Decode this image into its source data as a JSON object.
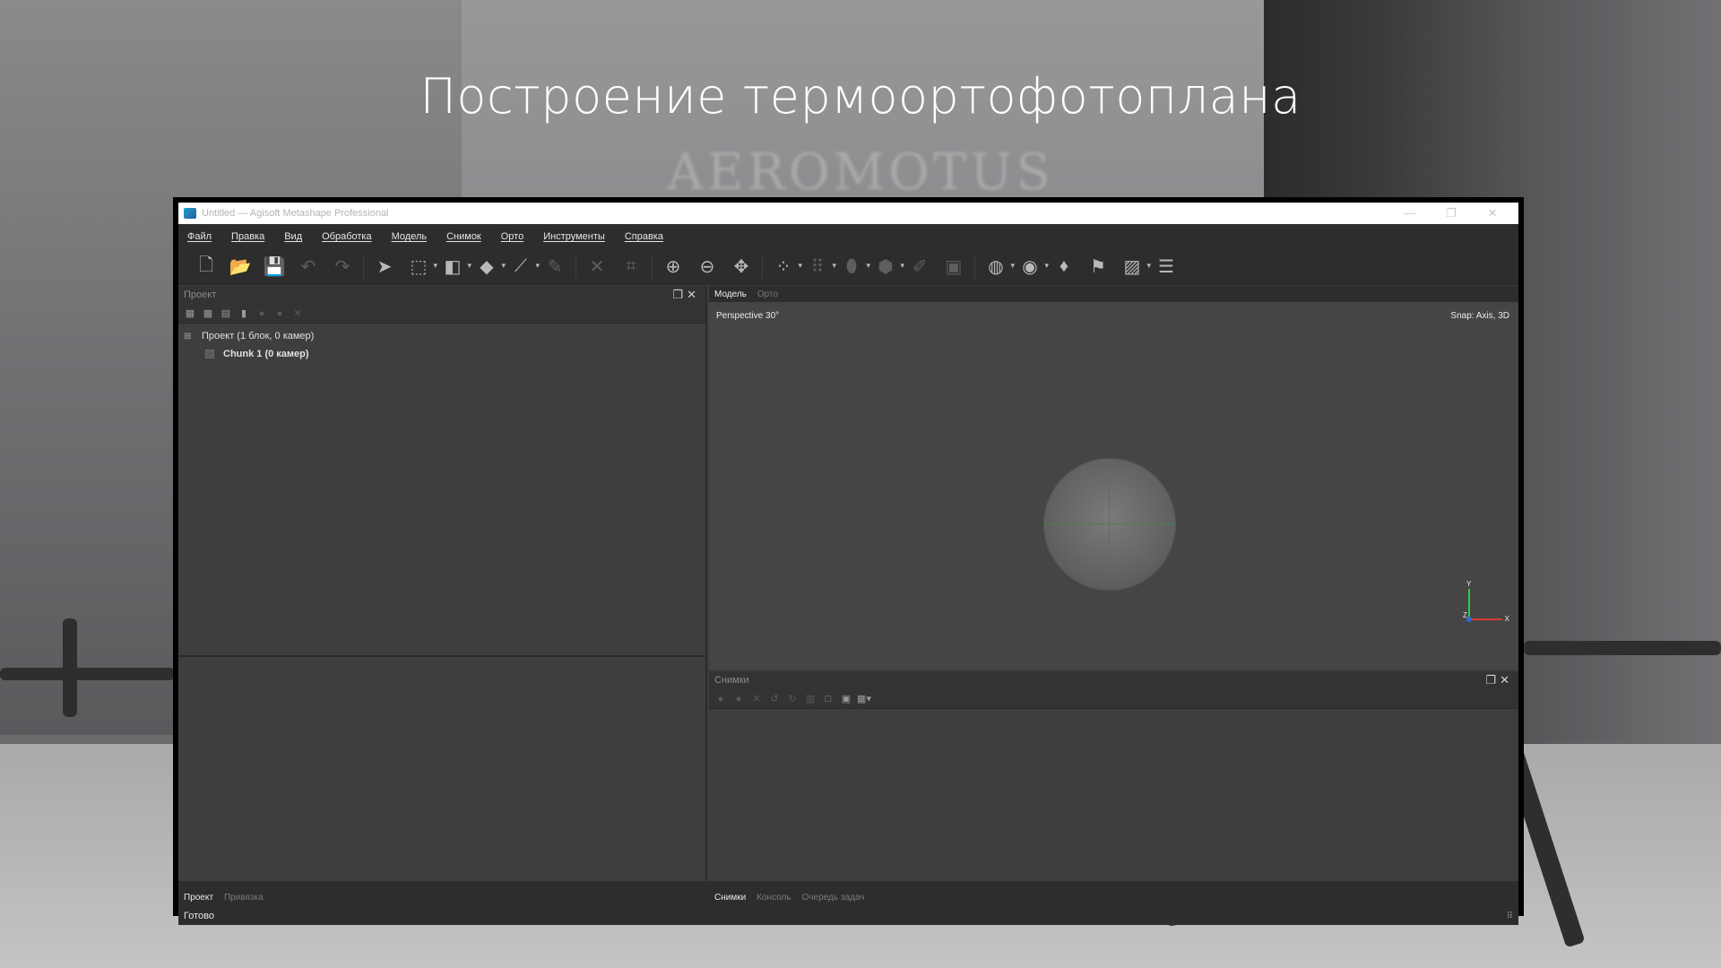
{
  "slide": {
    "title": "Построение термоортофотоплана",
    "background_logo": "AEROMOTUS"
  },
  "window": {
    "title": "Untitled — Agisoft Metashape Professional",
    "controls": [
      "—",
      "❐",
      "✕"
    ]
  },
  "menu": [
    "Файл",
    "Правка",
    "Вид",
    "Обработка",
    "Модель",
    "Снимок",
    "Орто",
    "Инструменты",
    "Справка"
  ],
  "toolbar": {
    "icons": [
      "new-file-icon",
      "open-folder-icon",
      "save-icon",
      "undo-icon",
      "redo-icon",
      "pointer-icon",
      "rectangle-select-icon",
      "shape-icon",
      "polygon-icon",
      "ruler-icon",
      "pencil-icon",
      "delete-icon",
      "crop-icon",
      "zoom-in-icon",
      "zoom-out-icon",
      "move-icon",
      "points-icon",
      "grid-points-icon",
      "mesh-icon",
      "texture-icon",
      "brush-icon",
      "tile-icon",
      "globe-icon",
      "camera-icon",
      "marker-icon",
      "flag-icon",
      "ortho-icon",
      "layers-icon"
    ]
  },
  "project_panel": {
    "header": "Проект",
    "tree": [
      {
        "label": "Проект (1 блок, 0 камер)"
      },
      {
        "label": "Chunk 1 (0 камер)"
      }
    ],
    "tabs": {
      "active": "Проект",
      "inactive": "Привязка"
    }
  },
  "viewport": {
    "tabs": {
      "active": "Модель",
      "inactive": "Орто"
    },
    "perspective_label": "Perspective 30°",
    "snap_label": "Snap: Axis, 3D",
    "axes": {
      "y": "Y",
      "x": "X",
      "z": "Z"
    }
  },
  "photos_panel": {
    "header": "Снимки",
    "tabs": {
      "active": "Снимки",
      "inactive1": "Консоль",
      "inactive2": "Очередь задач"
    }
  },
  "status": {
    "text": "Готово"
  }
}
